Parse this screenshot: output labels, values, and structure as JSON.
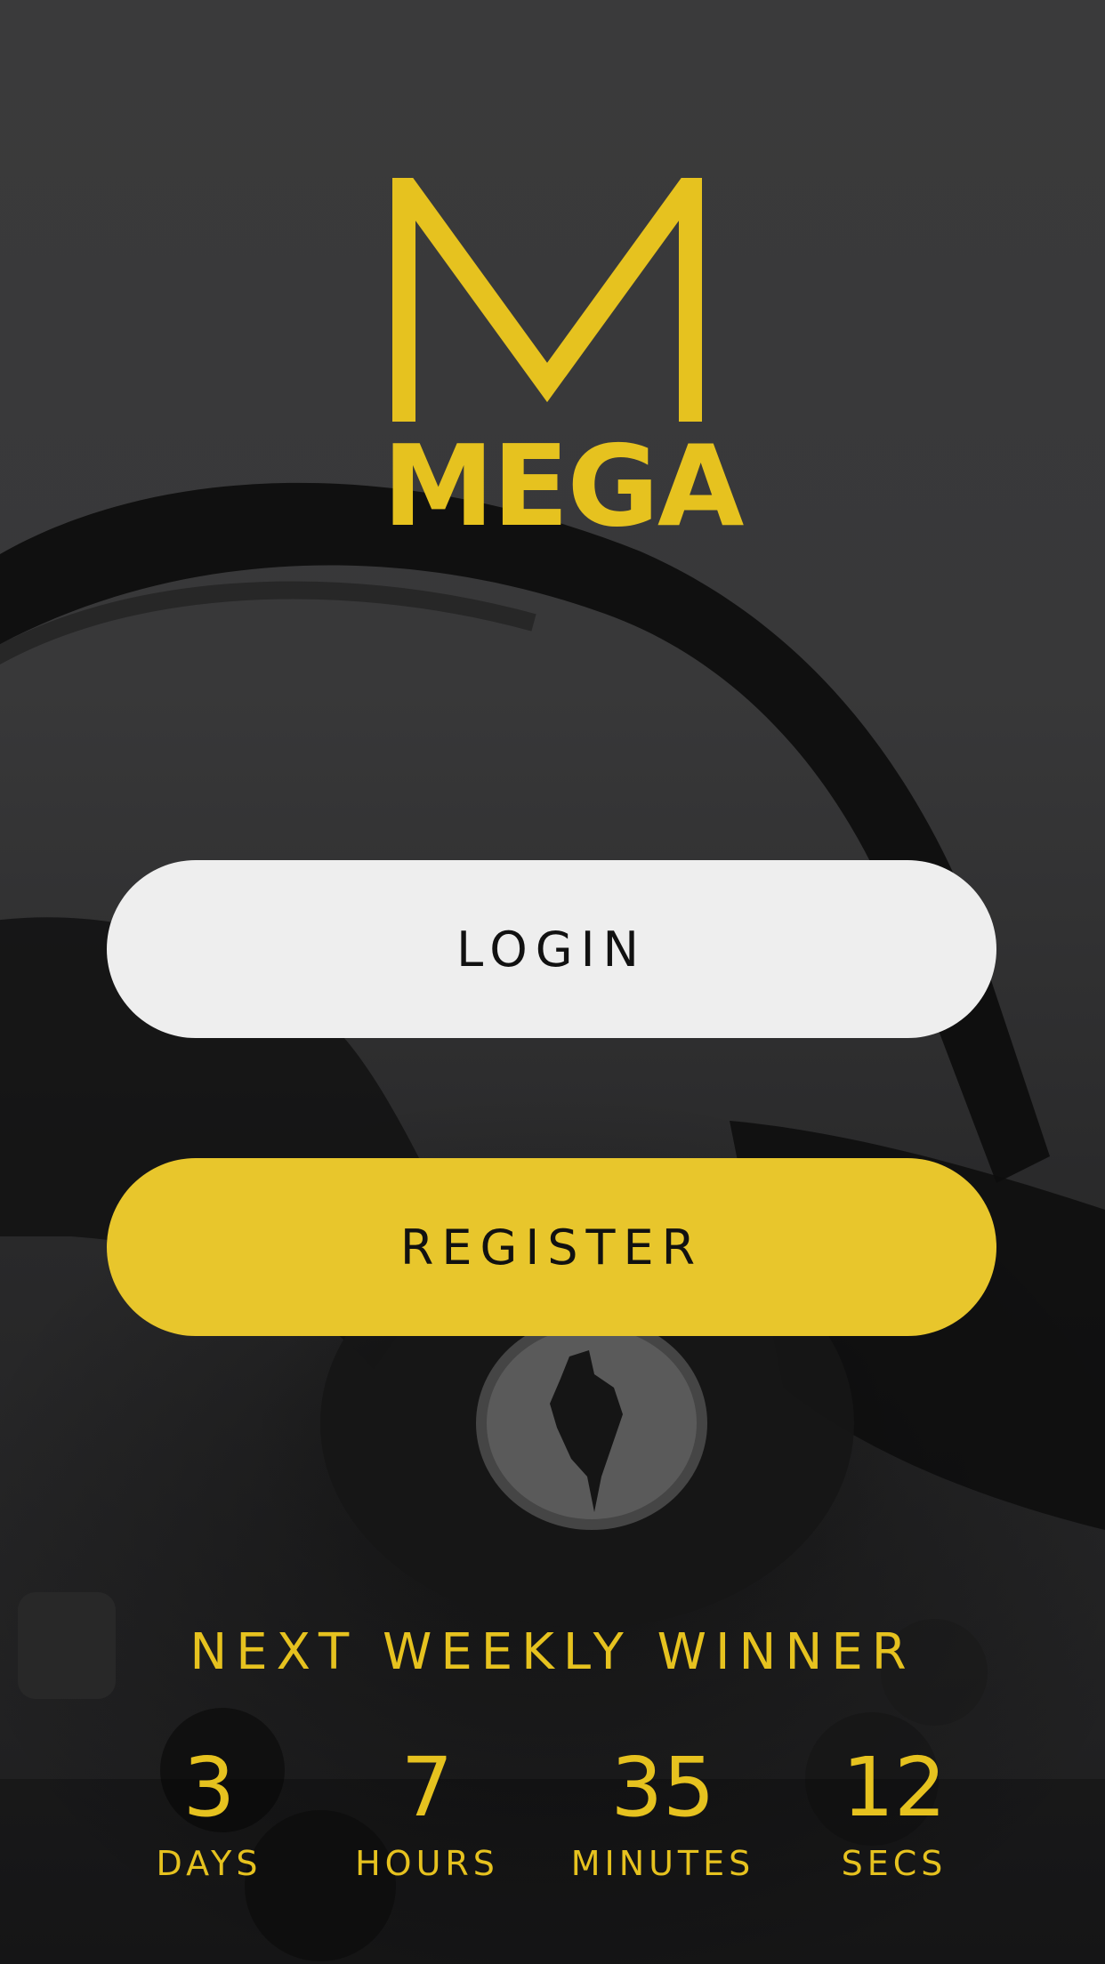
{
  "app": {
    "brand_name": "MEGA",
    "brand_color": "#e6c21f",
    "background_color": "#3a3a3b"
  },
  "logo": {
    "mark_icon": "m-monogram-icon",
    "wordmark": "MEGA"
  },
  "actions": {
    "login_label": "LOGIN",
    "login_color": "#eeeeee",
    "register_label": "REGISTER",
    "register_color": "#e8c62c"
  },
  "countdown": {
    "title": "NEXT WEEKLY WINNER",
    "units": [
      {
        "value": "3",
        "label": "DAYS"
      },
      {
        "value": "7",
        "label": "HOURS"
      },
      {
        "value": "35",
        "label": "MINUTES"
      },
      {
        "value": "12",
        "label": "SECS"
      }
    ]
  },
  "background_image": {
    "icon": "steering-wheel-photo"
  }
}
